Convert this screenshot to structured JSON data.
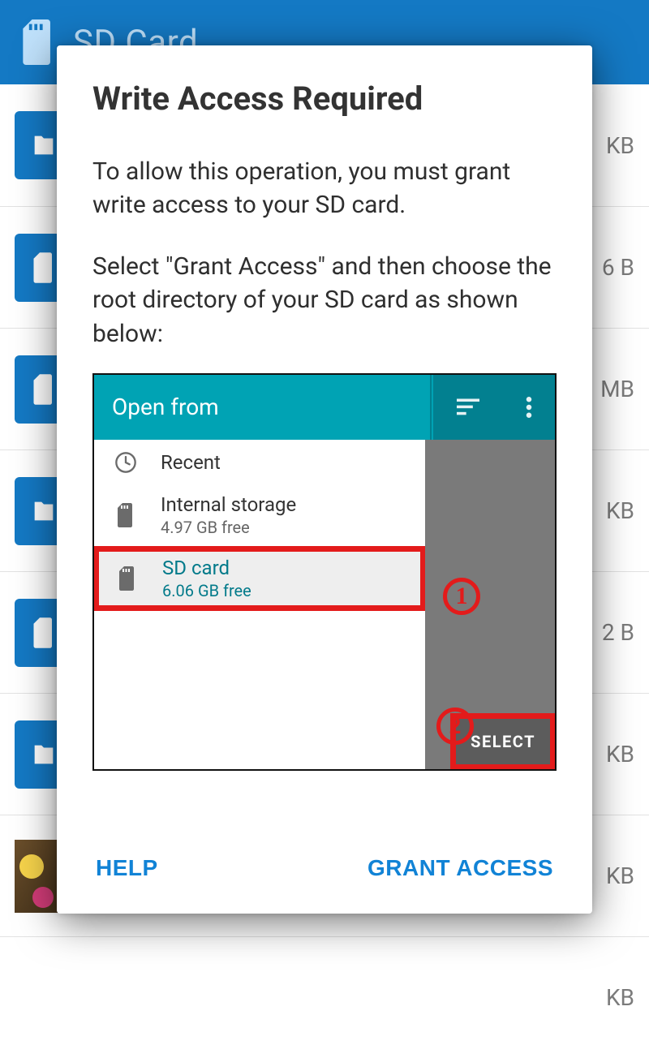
{
  "background": {
    "title": "SD Card",
    "rows": [
      {
        "icon": "file",
        "size": "KB"
      },
      {
        "icon": "sd",
        "size": "6 B"
      },
      {
        "icon": "sd",
        "size": "MB"
      },
      {
        "icon": "file",
        "size": "KB"
      },
      {
        "icon": "sd",
        "size": "2 B"
      },
      {
        "icon": "file",
        "size": "KB"
      },
      {
        "icon": "thumb",
        "size": "KB"
      },
      {
        "icon": "none",
        "size": "KB"
      }
    ]
  },
  "dialog": {
    "title": "Write Access Required",
    "paragraph1": "To allow this operation, you must grant write access to your SD card.",
    "paragraph2": "Select \"Grant Access\" and then choose the root directory of your SD card as shown below:",
    "help_label": "HELP",
    "grant_label": "GRANT ACCESS"
  },
  "tutorial": {
    "header_title": "Open from",
    "items": {
      "recent": {
        "label": "Recent"
      },
      "internal": {
        "label": "Internal storage",
        "sub": "4.97 GB free"
      },
      "sd": {
        "label": "SD card",
        "sub": "6.06 GB free"
      }
    },
    "step1": "1",
    "step2": "2",
    "select_label": "SELECT"
  }
}
